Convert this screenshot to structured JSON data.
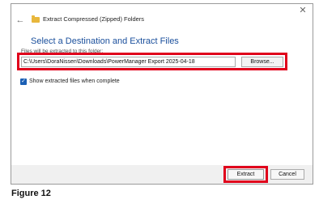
{
  "dialog": {
    "header_title": "Extract Compressed (Zipped) Folders",
    "section_title": "Select a Destination and Extract Files",
    "field_label": "Files will be extracted to this folder:",
    "path_value": "C:\\Users\\DoraNissen\\Downloads\\PowerManager Export 2025-04-18",
    "browse_label": "Browse...",
    "checkbox_label": "Show extracted files when complete",
    "checkbox_checked": true,
    "extract_label": "Extract",
    "cancel_label": "Cancel",
    "icons": {
      "close": "close-icon",
      "back": "back-arrow-icon",
      "folder": "zipped-folder-icon",
      "check": "checkmark-icon"
    }
  },
  "caption": "Figure 12",
  "colors": {
    "highlight": "#e0001b",
    "title_blue": "#1a4f9c",
    "checkbox_blue": "#1a5fb4",
    "folder_yellow": "#e8b73c"
  }
}
